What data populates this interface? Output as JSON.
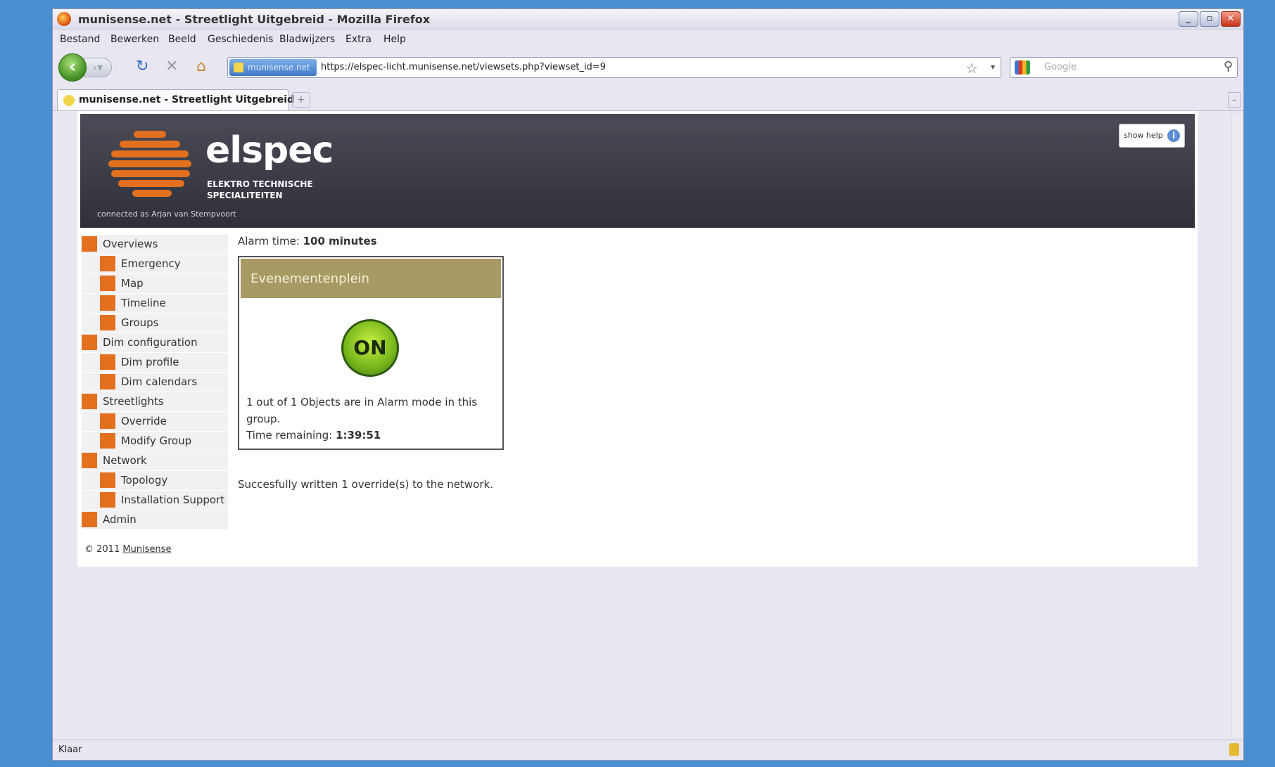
{
  "window": {
    "title": "munisense.net - Streetlight Uitgebreid - Mozilla Firefox",
    "controls": [
      "_",
      "▫",
      "✕"
    ]
  },
  "menu": [
    "Bestand",
    "Bewerken",
    "Beeld",
    "Geschiedenis",
    "Bladwijzers",
    "Extra",
    "Help"
  ],
  "navigation": {
    "site_badge": "munisense.net",
    "url": "https://elspec-licht.munisense.net/viewsets.php?viewset_id=9",
    "search_placeholder": "Google"
  },
  "tabs": [
    {
      "label": "munisense.net - Streetlight Uitgebreid"
    }
  ],
  "new_tab_symbol": "+",
  "header": {
    "brand": "elspec",
    "tagline": "ELEKTRO TECHNISCHE SPECIALITEITEN",
    "connected": "connected as Arjan van Stempvoort",
    "help_label": "show help",
    "help_icon": "i"
  },
  "sidebar": {
    "items": [
      {
        "label": "Overviews",
        "level": 1
      },
      {
        "label": "Emergency",
        "level": 2
      },
      {
        "label": "Map",
        "level": 2
      },
      {
        "label": "Timeline",
        "level": 2
      },
      {
        "label": "Groups",
        "level": 2
      },
      {
        "label": "Dim configuration",
        "level": 1
      },
      {
        "label": "Dim profile",
        "level": 2
      },
      {
        "label": "Dim calendars",
        "level": 2
      },
      {
        "label": "Streetlights",
        "level": 1
      },
      {
        "label": "Override",
        "level": 2
      },
      {
        "label": "Modify Group",
        "level": 2
      },
      {
        "label": "Network",
        "level": 1
      },
      {
        "label": "Topology",
        "level": 2
      },
      {
        "label": "Installation Support",
        "level": 2
      },
      {
        "label": "Admin",
        "level": 1
      }
    ]
  },
  "main": {
    "alarm_label": "Alarm time: ",
    "alarm_value": "100 minutes",
    "group": {
      "title": "Evenementenplein",
      "state": "ON",
      "status": "1 out of 1 Objects are in Alarm mode in this group.",
      "time_label": "Time remaining: ",
      "time_value": "1:39:51"
    },
    "success_message": "Succesfully written 1 override(s) to the network."
  },
  "footer": {
    "copyright": "© 2011 ",
    "link": "Munisense"
  },
  "status_bar": {
    "text": "Klaar"
  },
  "colors": {
    "accent": "#e2701e",
    "group_header": "#a99a63",
    "on_button": "#77b51c"
  }
}
